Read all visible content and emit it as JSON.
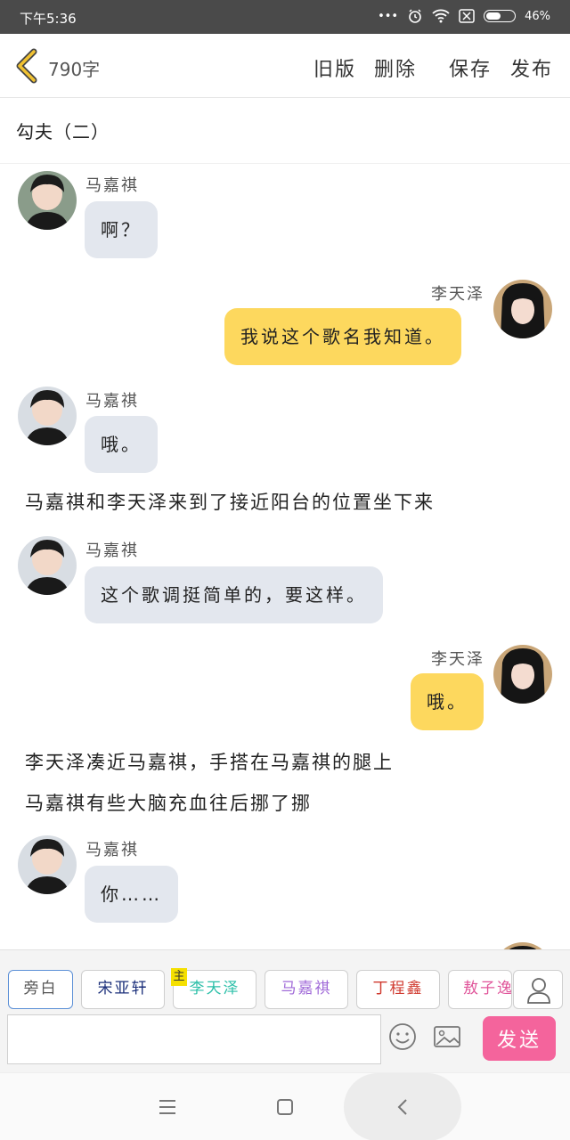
{
  "status": {
    "time": "下午5:36",
    "dots": "•••",
    "battery": "46%",
    "battery_level": 0.46
  },
  "toolbar": {
    "word_count": "790字",
    "old_version": "旧版",
    "delete": "删除",
    "save": "保存",
    "publish": "发布"
  },
  "title": "勾夫（二）",
  "messages": [
    {
      "side": "left",
      "name": "马嘉祺",
      "text": "啊？"
    },
    {
      "side": "right",
      "name": "李天泽",
      "text": "我说这个歌名我知道。"
    },
    {
      "side": "left",
      "name": "马嘉祺",
      "text": "哦。"
    },
    {
      "type": "narration",
      "text": "马嘉祺和李天泽来到了接近阳台的位置坐下来"
    },
    {
      "side": "left",
      "name": "马嘉祺",
      "text": "这个歌调挺简单的，要这样。"
    },
    {
      "side": "right",
      "name": "李天泽",
      "text": "哦。"
    },
    {
      "type": "narration",
      "text": "李天泽凑近马嘉祺，手搭在马嘉祺的腿上"
    },
    {
      "type": "narration",
      "text": "马嘉祺有些大脑充血往后挪了挪"
    },
    {
      "side": "left",
      "name": "马嘉祺",
      "text": "你……"
    }
  ],
  "characters": [
    {
      "label": "旁白",
      "color": "#555555",
      "active": true
    },
    {
      "label": "宋亚轩",
      "color": "#1b2f7a"
    },
    {
      "label": "李天泽",
      "color": "#2bbfa8",
      "badge": "主"
    },
    {
      "label": "马嘉祺",
      "color": "#a06ad8"
    },
    {
      "label": "丁程鑫",
      "color": "#d03a2f"
    },
    {
      "label": "敖子逸",
      "color": "#e0559a"
    }
  ],
  "composer": {
    "placeholder": "",
    "value": "",
    "send": "发送"
  },
  "icons": {
    "back": "chevron-left-icon",
    "emoji": "smile-icon",
    "image": "image-icon",
    "user": "user-icon"
  },
  "colors": {
    "left_bubble": "#e3e7ee",
    "right_bubble": "#fdd85e",
    "send": "#f4649c",
    "back_arrow": "#f1c232"
  }
}
